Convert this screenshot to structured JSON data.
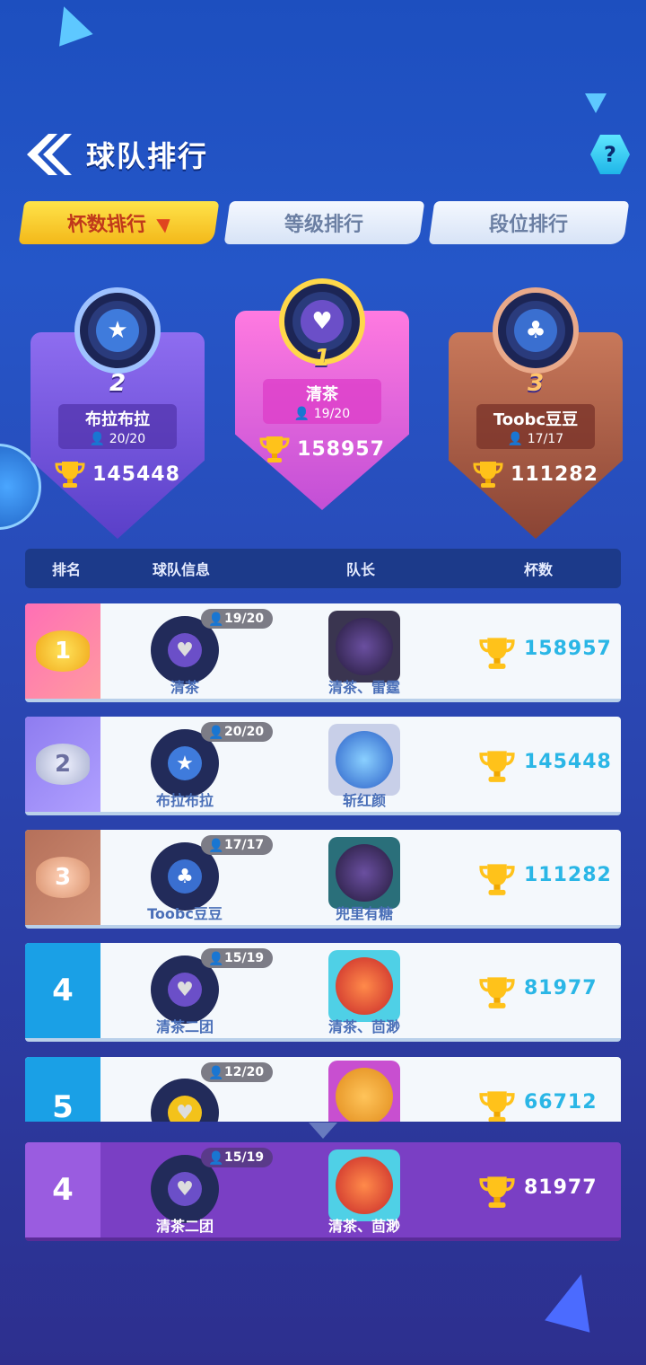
{
  "header": {
    "title": "球队排行"
  },
  "tabs": [
    {
      "label": "杯数排行",
      "active": true
    },
    {
      "label": "等级排行",
      "active": false
    },
    {
      "label": "段位排行",
      "active": false
    }
  ],
  "podium": [
    {
      "rank": "2",
      "name": "布拉布拉",
      "members": "20/20",
      "score": "145448",
      "color": "#7b5ce6"
    },
    {
      "rank": "1",
      "name": "清茶",
      "members": "19/20",
      "score": "158957",
      "color": "#e05bd8"
    },
    {
      "rank": "3",
      "name": "Toobc豆豆",
      "members": "17/17",
      "score": "111282",
      "color": "#b8624a"
    }
  ],
  "columns": {
    "rank": "排名",
    "team": "球队信息",
    "captain": "队长",
    "cups": "杯数"
  },
  "rows": [
    {
      "rank": "1",
      "members": "19/20",
      "team": "清茶",
      "captain": "清茶、雷霆",
      "score": "158957"
    },
    {
      "rank": "2",
      "members": "20/20",
      "team": "布拉布拉",
      "captain": "斩红颜",
      "score": "145448"
    },
    {
      "rank": "3",
      "members": "17/17",
      "team": "Toobc豆豆",
      "captain": "兜里有糖",
      "score": "111282"
    },
    {
      "rank": "4",
      "members": "15/19",
      "team": "清茶二团",
      "captain": "清茶、茴渺",
      "score": "81977"
    },
    {
      "rank": "5",
      "members": "12/20",
      "team": "",
      "captain": "",
      "score": "66712"
    }
  ],
  "my_team": {
    "rank": "4",
    "members": "15/19",
    "team": "清茶二团",
    "captain": "清茶、茴渺",
    "score": "81977"
  }
}
